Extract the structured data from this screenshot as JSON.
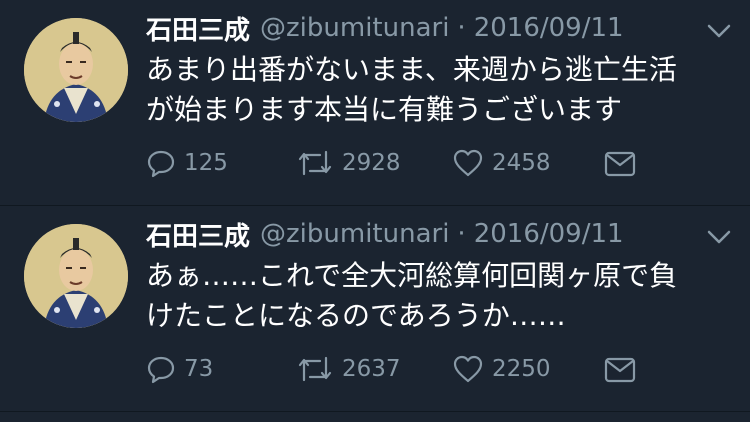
{
  "theme": {
    "background": "#1b2430",
    "text": "#ffffff",
    "muted": "#8899a6"
  },
  "tweets": [
    {
      "name": "石田三成",
      "handle": "@zibumitunari",
      "separator": "·",
      "date": "2016/09/11",
      "line1": "あまり出番がないまま、来週から逃亡生活",
      "line2": "が始まります本当に有難うございます",
      "replies": "125",
      "retweets": "2928",
      "likes": "2458",
      "icons": [
        "reply-icon",
        "retweet-icon",
        "like-icon",
        "message-icon",
        "chevron-down-icon"
      ]
    },
    {
      "name": "石田三成",
      "handle": "@zibumitunari",
      "separator": "·",
      "date": "2016/09/11",
      "line1": "あぁ……これで全大河総算何回関ヶ原で負",
      "line2": "けたことになるのであろうか……",
      "replies": "73",
      "retweets": "2637",
      "likes": "2250",
      "icons": [
        "reply-icon",
        "retweet-icon",
        "like-icon",
        "message-icon",
        "chevron-down-icon"
      ]
    }
  ]
}
